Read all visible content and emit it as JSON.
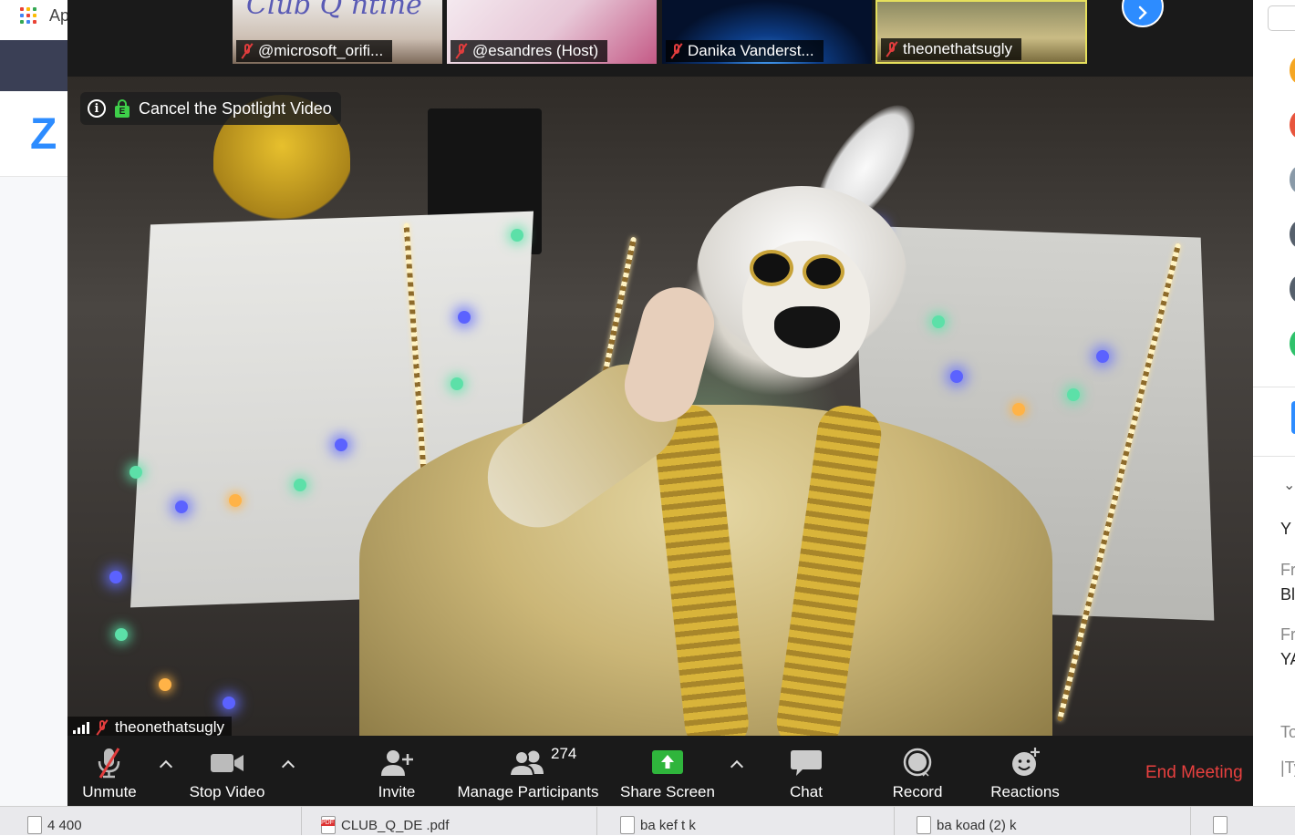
{
  "background_page": {
    "apps_label": "Ap",
    "logo_text": "Z",
    "right_panel": {
      "lines": [
        {
          "text": "Y",
          "style": "normal"
        },
        {
          "text": "Fr",
          "style": "small"
        },
        {
          "text": "Bl",
          "style": "normal"
        },
        {
          "text": "Fr",
          "style": "small"
        },
        {
          "text": "YA",
          "style": "normal"
        },
        {
          "text": "To",
          "style": "small"
        },
        {
          "text": "|Ty",
          "style": "small"
        }
      ],
      "avatar_colors": [
        "#f5a623",
        "#e8553d",
        "#8a9aa8",
        "#56606c",
        "#56606c",
        "#2fc26b"
      ]
    }
  },
  "dock": {
    "items": [
      {
        "label": "  4  400   ",
        "icon": "document-icon"
      },
      {
        "label": "CLUB_Q_DE .pdf",
        "icon": "pdf-icon"
      },
      {
        "label": "  ba  kef  t  k",
        "icon": "document-icon"
      },
      {
        "label": "     ba  koad (2) k",
        "icon": "document-icon"
      },
      {
        "label": "",
        "icon": "document-icon"
      }
    ]
  },
  "gallery": {
    "thumbnails": [
      {
        "name": "@microsoft_orifi...",
        "muted": true
      },
      {
        "name": "@esandres (Host)",
        "muted": true
      },
      {
        "name": "Danika Vanderst...",
        "muted": true
      },
      {
        "name": "theonethatsugly",
        "muted": true,
        "active_speaker": true
      }
    ],
    "thumb_overlay_text": "Club Q  ntine",
    "next_icon": "chevron-right-icon"
  },
  "spotlight": {
    "cancel_label": "Cancel the Spotlight Video",
    "info_icon": "info-icon",
    "lock_icon": "encryption-lock-icon"
  },
  "active_video": {
    "speaker_name": "theonethatsugly",
    "signal_icon": "signal-strength-icon",
    "muted": true
  },
  "toolbar": {
    "unmute_label": "Unmute",
    "stop_video_label": "Stop Video",
    "invite_label": "Invite",
    "manage_participants_label": "Manage Participants",
    "participants_count": "274",
    "share_screen_label": "Share Screen",
    "chat_label": "Chat",
    "record_label": "Record",
    "reactions_label": "Reactions",
    "end_meeting_label": "End Meeting",
    "colors": {
      "share_green": "#2fb53c",
      "end_red": "#e8403f",
      "mute_red": "#e23d3d"
    }
  }
}
